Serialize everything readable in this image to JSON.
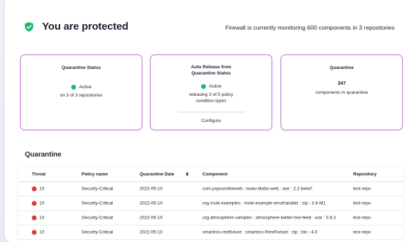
{
  "header": {
    "title": "You are protected",
    "summary": "Firewall is currently monitoring 600 components in 3 repositories"
  },
  "cards": {
    "quarantine_status": {
      "title": "Quarantine Status",
      "status": "Active",
      "detail": "on 3 of 3 repositories"
    },
    "auto_release": {
      "title_line1": "Auto Release from",
      "title_line2": "Quarantine Status",
      "status": "Active",
      "detail_line1": "releasing 3 of 5 policy",
      "detail_line2": "condition types",
      "configure_label": "Configure"
    },
    "quarantine_count": {
      "title": "Quarantine",
      "count": "347",
      "detail": "components in quarantine"
    }
  },
  "quarantine_section": {
    "title": "Quarantine",
    "columns": {
      "threat": "Threat",
      "policy": "Policy name",
      "date": "Quarantine Date",
      "sort_icon": "⬍",
      "component": "Component",
      "repository": "Repository"
    },
    "rows": [
      {
        "threat": "10",
        "policy": "Security-Critical",
        "date": "2022-05-10",
        "component": "com.pojosontheweb : woko-blobs-web : war : 2.2-beta7",
        "repository": "test-repo"
      },
      {
        "threat": "10",
        "policy": "Security-Critical",
        "date": "2022-05-10",
        "component": "org.mule.examples : mule-example-errorhandler : zip : 3.4-M1",
        "repository": "test-repo"
      },
      {
        "threat": "10",
        "policy": "Security-Critical",
        "date": "2022-05-10",
        "component": "org.atmosphere.samples : atmosphere-twitter-live-feed : war : 0.8.2",
        "repository": "test-repo"
      },
      {
        "threat": "10",
        "policy": "Security-Critical",
        "date": "2022-05-10",
        "component": "smartrics.restfixture : smartrics-RestFixture : zip : bin : 4.0",
        "repository": "test-repo"
      }
    ]
  },
  "colors": {
    "accent_border": "#c26fd4",
    "active_green": "#1db974",
    "threat_red": "#d83a3a"
  },
  "icons": {
    "header": "shield-check-icon",
    "status": "status-dot-icon",
    "threat": "threat-dot-icon",
    "sort": "sort-icon"
  }
}
